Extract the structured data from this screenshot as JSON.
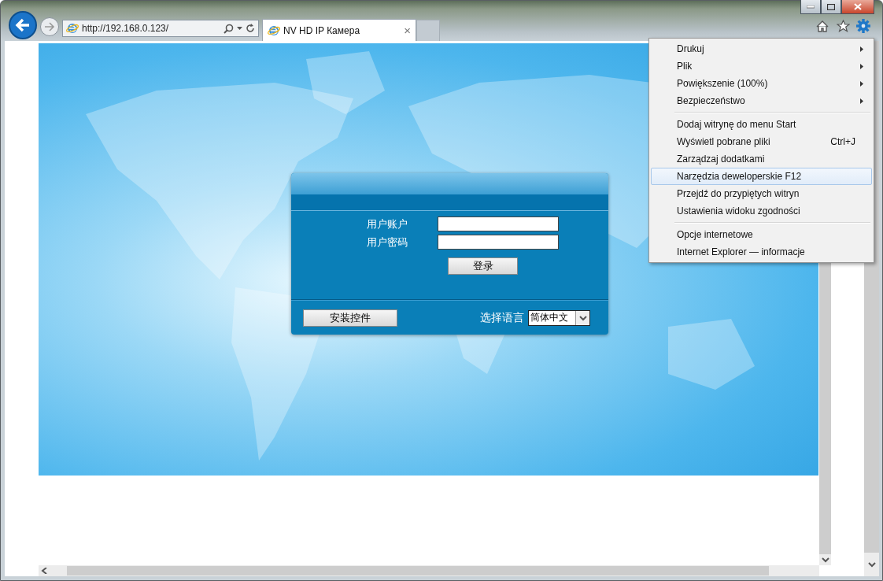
{
  "address_bar": {
    "value": "http://192.168.0.123/"
  },
  "tab": {
    "title": "NV HD IP Камера",
    "close": "×"
  },
  "login": {
    "fields": [
      {
        "label": "用户账户"
      },
      {
        "label": "用户密码"
      }
    ],
    "submit": "登录",
    "install_button": "安装控件",
    "language": {
      "label": "选择语言",
      "value": "简体中文"
    }
  },
  "menu": {
    "groups": [
      [
        {
          "label": "Drukuj",
          "submenu": true,
          "selected": false
        },
        {
          "label": "Plik",
          "submenu": true,
          "selected": false
        },
        {
          "label": "Powiększenie (100%)",
          "submenu": true,
          "selected": false
        },
        {
          "label": "Bezpieczeństwo",
          "submenu": true,
          "selected": false
        }
      ],
      [
        {
          "label": "Dodaj witrynę do menu Start",
          "submenu": false,
          "selected": false
        },
        {
          "label": "Wyświetl pobrane pliki",
          "shortcut": "Ctrl+J",
          "submenu": false,
          "selected": false
        },
        {
          "label": "Zarządzaj dodatkami",
          "submenu": false,
          "selected": false
        },
        {
          "label": "Narzędzia deweloperskie F12",
          "submenu": false,
          "selected": true
        },
        {
          "label": "Przejdź do przypiętych witryn",
          "submenu": false,
          "selected": false
        },
        {
          "label": "Ustawienia widoku zgodności",
          "submenu": false,
          "selected": false
        }
      ],
      [
        {
          "label": "Opcje internetowe",
          "submenu": false,
          "selected": false
        },
        {
          "label": "Internet Explorer — informacje",
          "submenu": false,
          "selected": false
        }
      ]
    ]
  }
}
